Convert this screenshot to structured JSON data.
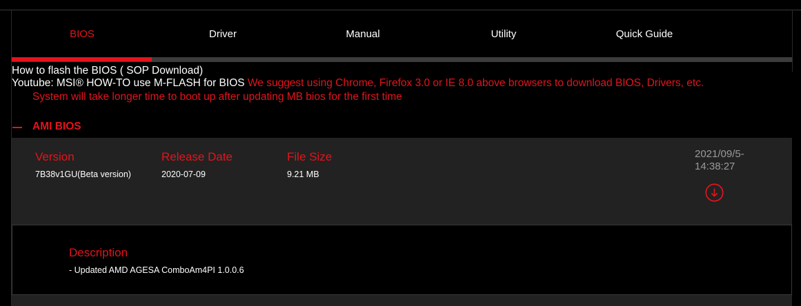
{
  "tabs": [
    {
      "label": "BIOS",
      "active": true
    },
    {
      "label": "Driver",
      "active": false
    },
    {
      "label": "Manual",
      "active": false
    },
    {
      "label": "Utility",
      "active": false
    },
    {
      "label": "Quick Guide",
      "active": false
    }
  ],
  "info": {
    "flash_link": "How to flash the BIOS ( SOP Download)",
    "youtube_link": "Youtube: MSI® HOW-TO use M-FLASH for BIOS",
    "browser_notice": "We suggest using Chrome, Firefox 3.0 or IE 8.0 above browsers to download BIOS, Drivers, etc.",
    "boot_notice": "System will take longer time to boot up after updating MB bios for the first time"
  },
  "section": {
    "title": "AMI BIOS",
    "collapse_icon": "minus-icon"
  },
  "download": {
    "version_label": "Version",
    "version_value": "7B38v1GU(Beta version)",
    "release_label": "Release Date",
    "release_value": "2020-07-09",
    "size_label": "File Size",
    "size_value": "9.21 MB",
    "timestamp_date": "2021/09/5-",
    "timestamp_time": "14:38:27",
    "download_icon": "download-arrow-icon"
  },
  "description": {
    "heading": "Description",
    "text": "- Updated AMD AGESA ComboAm4PI 1.0.0.6"
  },
  "colors": {
    "accent": "#e4141c",
    "background": "#000000",
    "card": "#222222",
    "muted": "#9a9a9a"
  }
}
